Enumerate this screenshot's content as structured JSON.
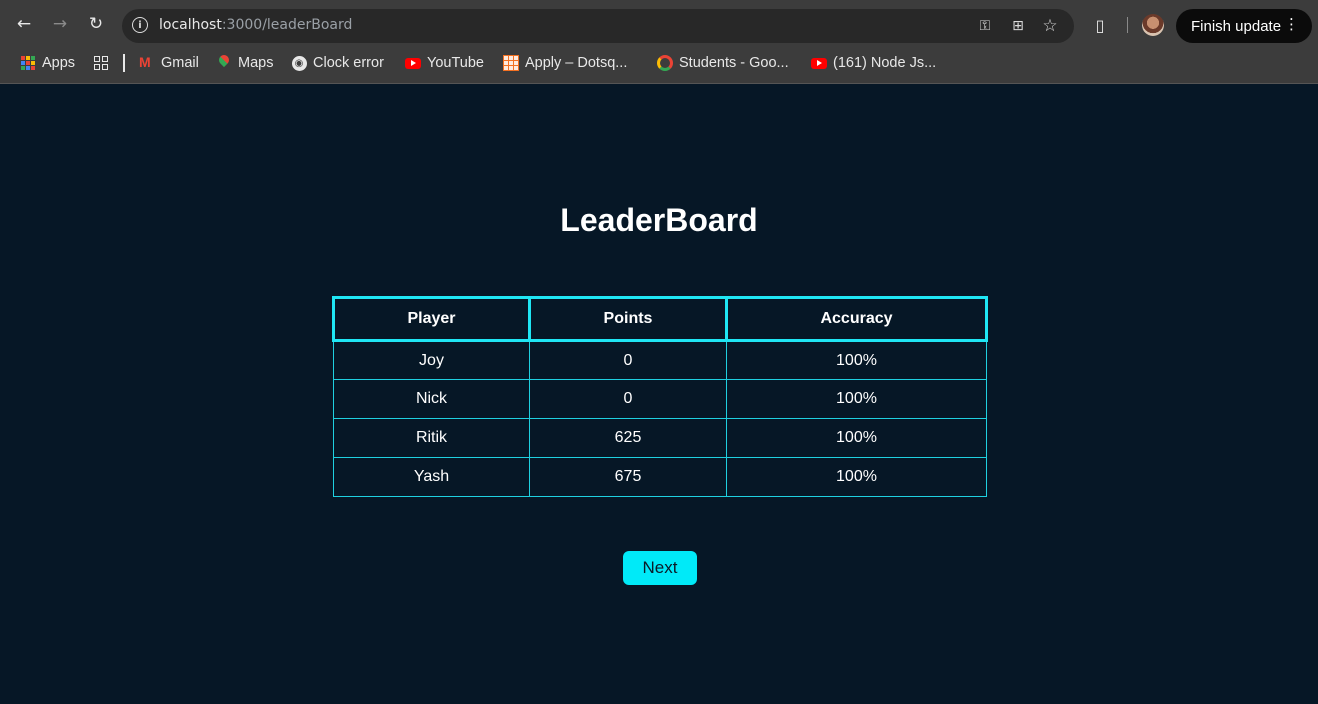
{
  "browser": {
    "url_host": "localhost",
    "url_path": ":3000/leaderBoard",
    "finish_update_label": "Finish update",
    "bookmarks": [
      {
        "label": "Apps",
        "icon": "apps-grid-icon"
      },
      {
        "label": "Gmail",
        "icon": "gmail-icon"
      },
      {
        "label": "Maps",
        "icon": "maps-pin-icon"
      },
      {
        "label": "Clock error",
        "icon": "globe-icon"
      },
      {
        "label": "YouTube",
        "icon": "youtube-icon"
      },
      {
        "label": "Apply – Dotsq...",
        "icon": "dotsquares-icon"
      },
      {
        "label": "Students - Goo...",
        "icon": "google-icon"
      },
      {
        "label": "(161) Node Js...",
        "icon": "youtube-icon"
      }
    ]
  },
  "page": {
    "title": "LeaderBoard",
    "table": {
      "headers": [
        "Player",
        "Points",
        "Accuracy"
      ],
      "rows": [
        [
          "Joy",
          "0",
          "100%"
        ],
        [
          "Nick",
          "0",
          "100%"
        ],
        [
          "Ritik",
          "625",
          "100%"
        ],
        [
          "Yash",
          "675",
          "100%"
        ]
      ]
    },
    "next_label": "Next"
  },
  "colors": {
    "page_background": "#061726",
    "table_border": "#1fe6f4",
    "button_background": "#00eaf8",
    "text": "#ffffff"
  }
}
